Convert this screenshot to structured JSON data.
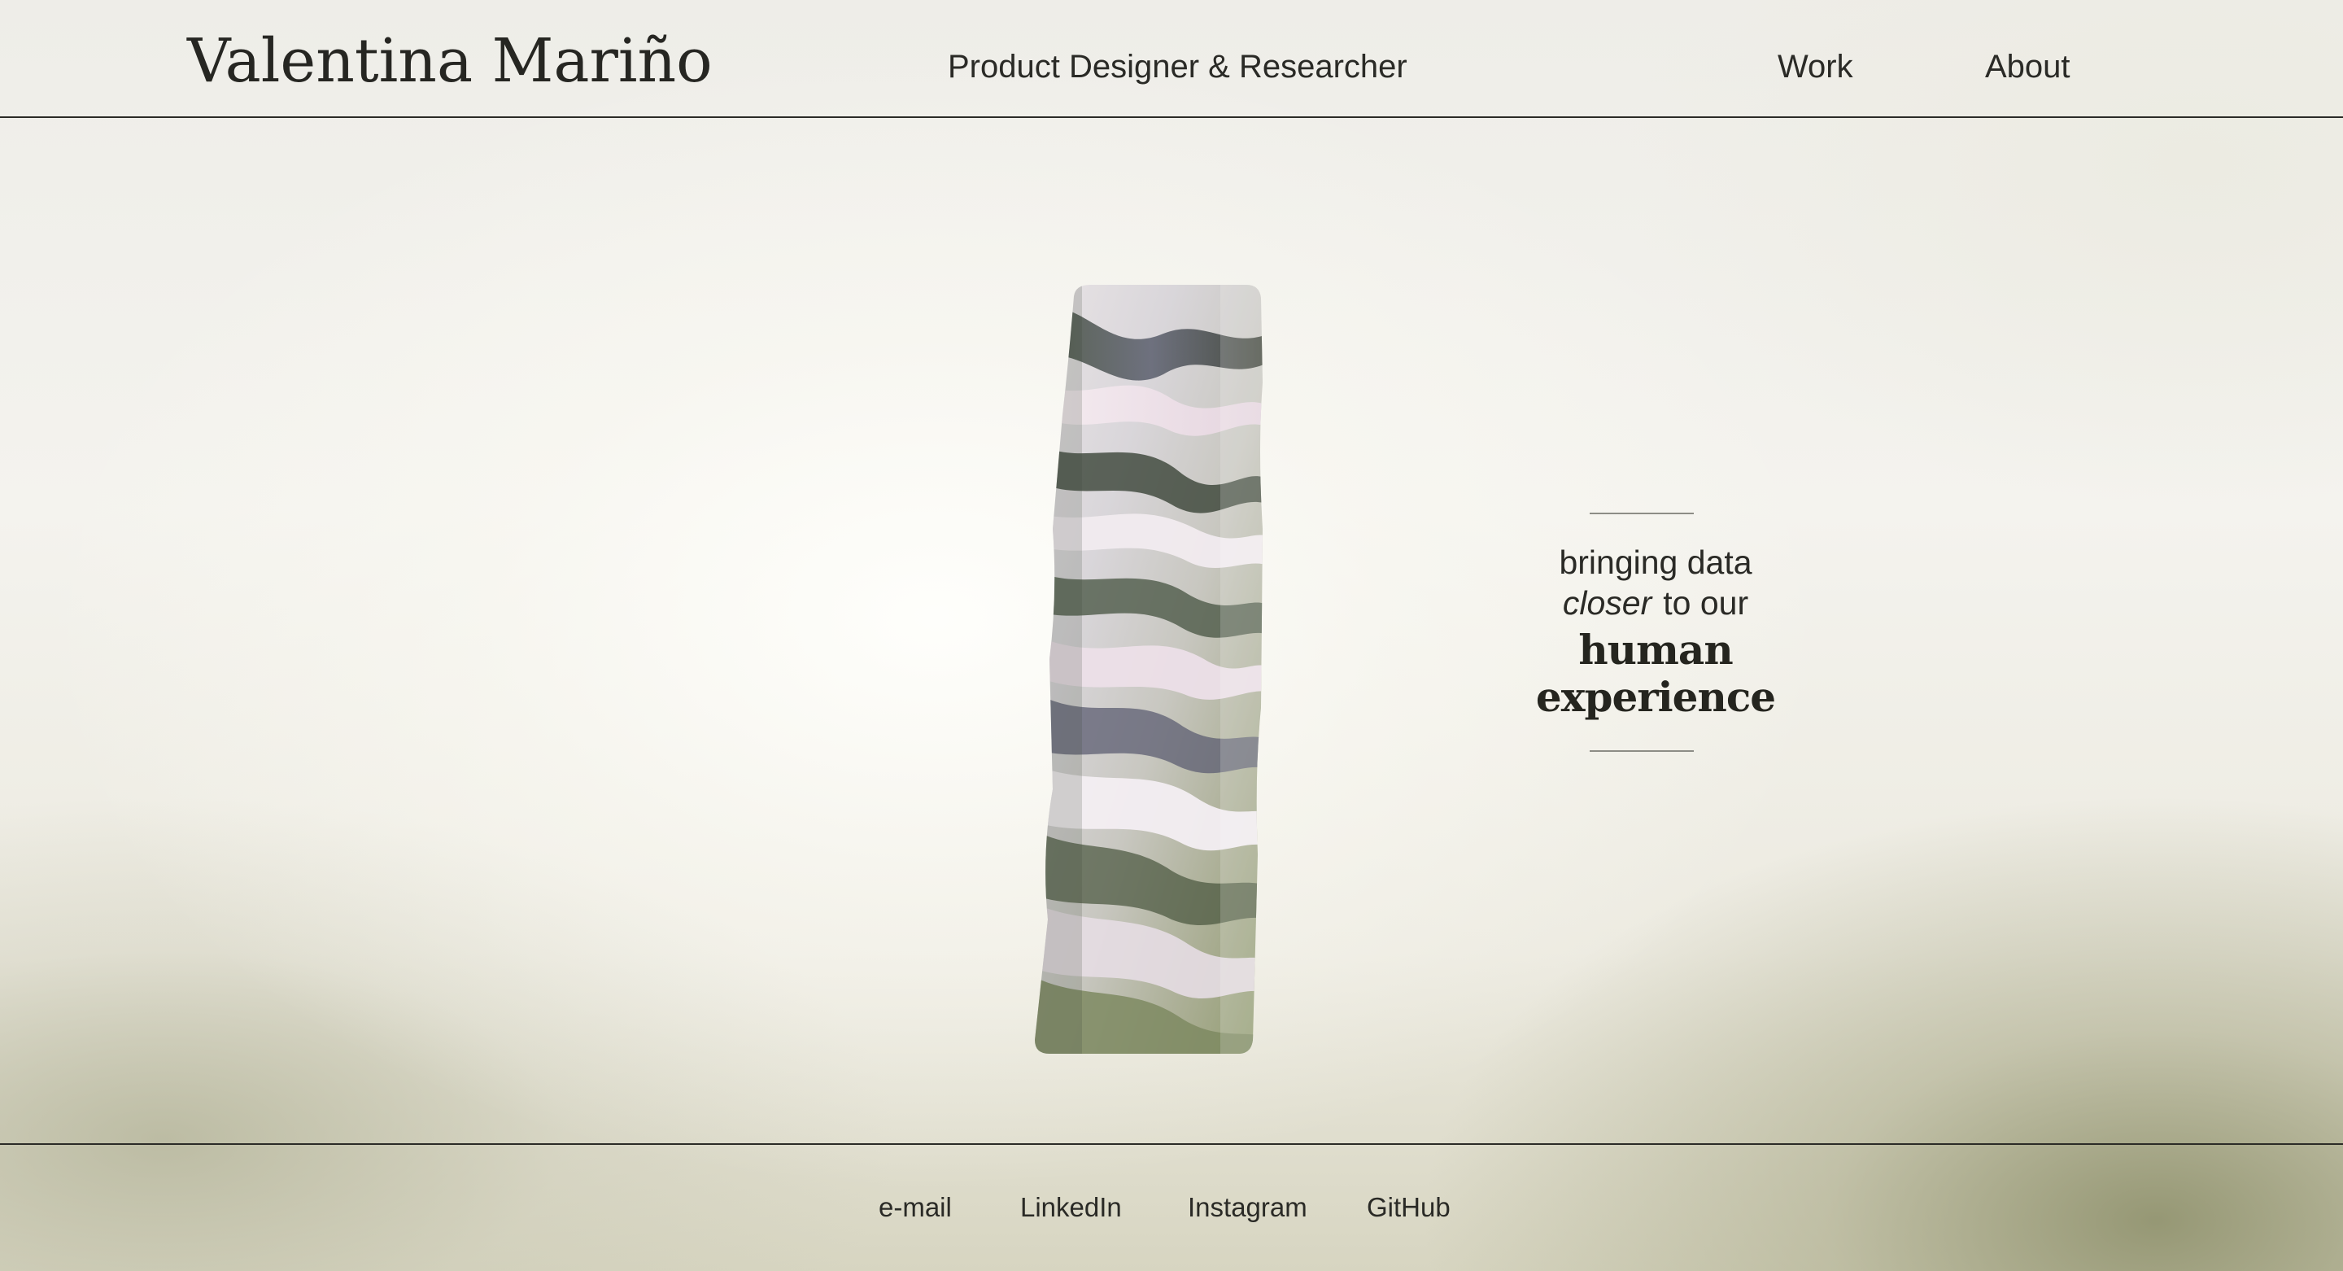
{
  "header": {
    "brand": "Valentina Mariño",
    "tagline": "Product Designer & Researcher",
    "nav": {
      "work": "Work",
      "about": "About"
    }
  },
  "hero": {
    "art_icon": "liquid-marble-bar-icon",
    "slogan": {
      "line1": "bringing data",
      "line2_em": "closer",
      "line2_rest": "to our",
      "line3": "human experience"
    }
  },
  "footer": {
    "links": {
      "email": "e-mail",
      "linkedin": "LinkedIn",
      "instagram": "Instagram",
      "github": "GitHub"
    }
  },
  "colors": {
    "text": "#2a2a26",
    "rule": "#8d8d86",
    "background_light": "#f4f3ee",
    "background_olive": "#929470"
  }
}
